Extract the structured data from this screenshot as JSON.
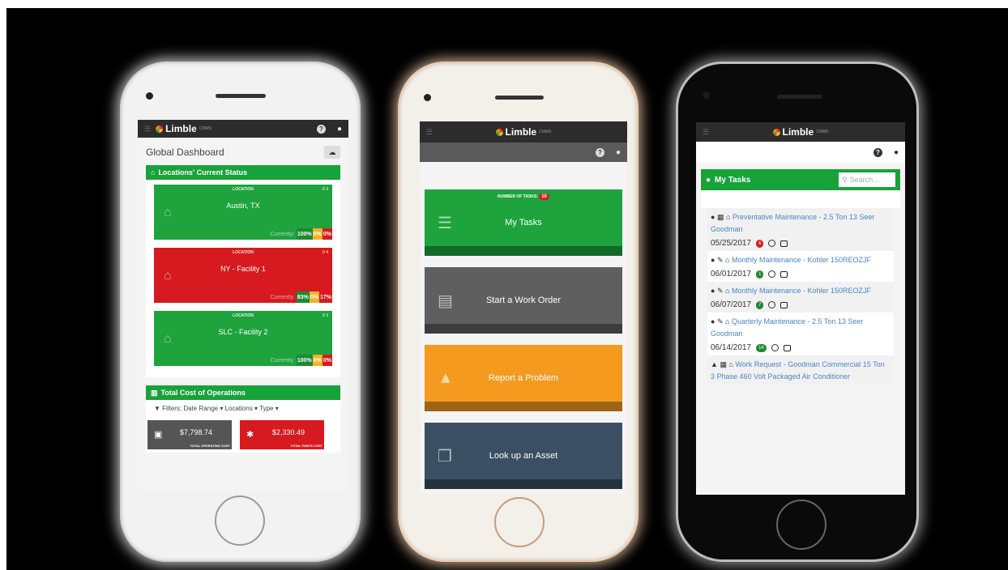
{
  "brand": {
    "name": "Limble",
    "sub": "CMMS"
  },
  "icons": {
    "help": "question-icon",
    "user": "user-icon",
    "menu": "menu-icon"
  },
  "phone1": {
    "page_title": "Global Dashboard",
    "locations_header": "Locations' Current Status",
    "location_label": "LOCATION",
    "currently_label": "Currently:",
    "locations": [
      {
        "name": "Austin, TX",
        "status": "green",
        "stat": "0 3",
        "seg": [
          "100%",
          "0%",
          "0%"
        ]
      },
      {
        "name": "NY - Facility 1",
        "status": "red",
        "stat": "0 4",
        "seg": [
          "83%",
          "0%",
          "17%"
        ]
      },
      {
        "name": "SLC - Facility 2",
        "status": "green",
        "stat": "0 3",
        "seg": [
          "100%",
          "0%",
          "0%"
        ]
      }
    ],
    "cost_header": "Total Cost of Operations",
    "filters": {
      "label": "Filters:",
      "date": "Date Range",
      "locations": "Locations",
      "type": "Type"
    },
    "costs": [
      {
        "amount": "$7,798.74",
        "label": "TOTAL OPERATING COST"
      },
      {
        "amount": "$2,330.49",
        "label": "TOTAL PARTS COST"
      }
    ]
  },
  "phone2": {
    "task_count_label": "NUMBER OF TASKS:",
    "task_count": "10",
    "buttons": [
      {
        "label": "My Tasks"
      },
      {
        "label": "Start a Work Order"
      },
      {
        "label": "Report a Problem"
      },
      {
        "label": "Look up an Asset"
      }
    ]
  },
  "phone3": {
    "header": "My Tasks",
    "search_placeholder": "Search...",
    "tasks": [
      {
        "title": "Preventative Maintenance - 2.5 Ton 13 Seer Goodman",
        "date": "05/25/2017",
        "badge": "6"
      },
      {
        "title": "Monthly Maintenance - Kohler 150REOZJF",
        "date": "06/01/2017",
        "badge": "1"
      },
      {
        "title": "Monthly Maintenance - Kohler 150REOZJF",
        "date": "06/07/2017",
        "badge": "7"
      },
      {
        "title": "Quarterly Maintenance - 2.5 Ton 13 Seer Goodman",
        "date": "06/14/2017",
        "badge": "14"
      },
      {
        "title": "Work Request - Goodman Commercial 15 Ton 3 Phase 460 Volt Packaged Air Conditioner"
      }
    ]
  }
}
